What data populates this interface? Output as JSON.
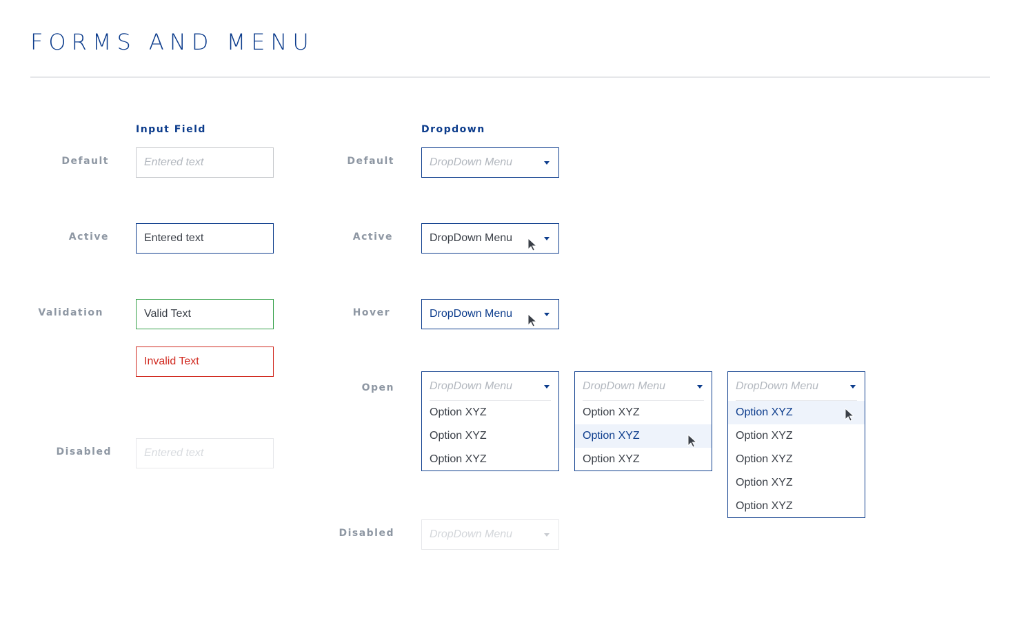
{
  "page": {
    "title": "FORMS AND MENU"
  },
  "input_section": {
    "title": "Input Field",
    "default": {
      "label": "Default",
      "placeholder": "Entered text"
    },
    "active": {
      "label": "Active",
      "value": "Entered text"
    },
    "validation": {
      "label": "Validation",
      "valid_value": "Valid Text",
      "invalid_value": "Invalid Text"
    },
    "disabled": {
      "label": "Disabled",
      "placeholder": "Entered text"
    }
  },
  "dropdown_section": {
    "title": "Dropdown",
    "default": {
      "label": "Default",
      "placeholder": "DropDown Menu"
    },
    "active": {
      "label": "Active",
      "value": "DropDown Menu"
    },
    "hover": {
      "label": "Hover",
      "value": "DropDown Menu"
    },
    "open": {
      "label": "Open",
      "menus": [
        {
          "placeholder": "DropDown Menu",
          "options": [
            "Option XYZ",
            "Option XYZ",
            "Option XYZ"
          ],
          "highlighted_option": null
        },
        {
          "placeholder": "DropDown Menu",
          "options": [
            "Option XYZ",
            "Option XYZ",
            "Option XYZ"
          ],
          "highlighted_option": 2
        },
        {
          "placeholder": "DropDown Menu",
          "options": [
            "Option XYZ",
            "Option XYZ",
            "Option XYZ",
            "Option XYZ",
            "Option XYZ"
          ],
          "highlighted_option": 1
        }
      ]
    },
    "disabled": {
      "label": "Disabled",
      "placeholder": "DropDown Menu"
    }
  },
  "colors": {
    "brand_blue": "#0c3c8c",
    "label_gray": "#8e97a3",
    "border_gray": "#c7c9cd",
    "valid_green": "#34a048",
    "invalid_red": "#d0281e",
    "option_highlight": "#eef3fb"
  },
  "icons": {
    "caret": "caret-down-icon",
    "cursor": "mouse-pointer-icon"
  }
}
